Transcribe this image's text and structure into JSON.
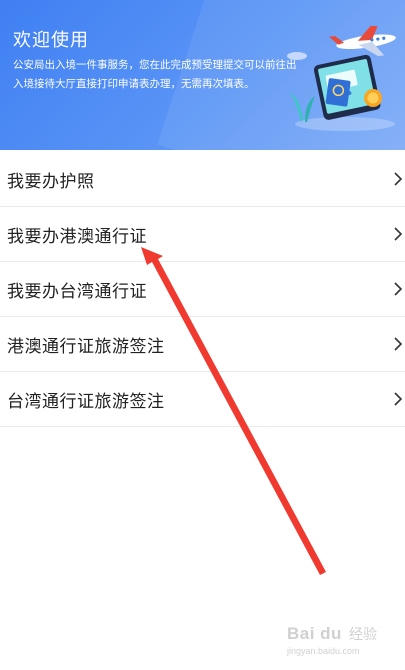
{
  "banner": {
    "title": "欢迎使用",
    "description": "公安局出入境一件事服务，您在此完成预受理提交可以前往出入境接待大厅直接打印申请表办理，无需再次填表。"
  },
  "menu": {
    "items": [
      {
        "label": "我要办护照",
        "icon": "chevron-right-icon"
      },
      {
        "label": "我要办港澳通行证",
        "icon": "chevron-right-icon"
      },
      {
        "label": "我要办台湾通行证",
        "icon": "chevron-right-icon"
      },
      {
        "label": "港澳通行证旅游签注",
        "icon": "chevron-right-icon"
      },
      {
        "label": "台湾通行证旅游签注",
        "icon": "chevron-right-icon"
      }
    ]
  },
  "annotation": {
    "color": "#f03a30",
    "icon": "red-arrow"
  },
  "watermark": {
    "logo": "Bai du",
    "label": "经验",
    "url": "jingyan.baidu.com"
  },
  "colors": {
    "banner": "#4a87f3",
    "text": "#222222",
    "divider": "#e9e9e9"
  }
}
